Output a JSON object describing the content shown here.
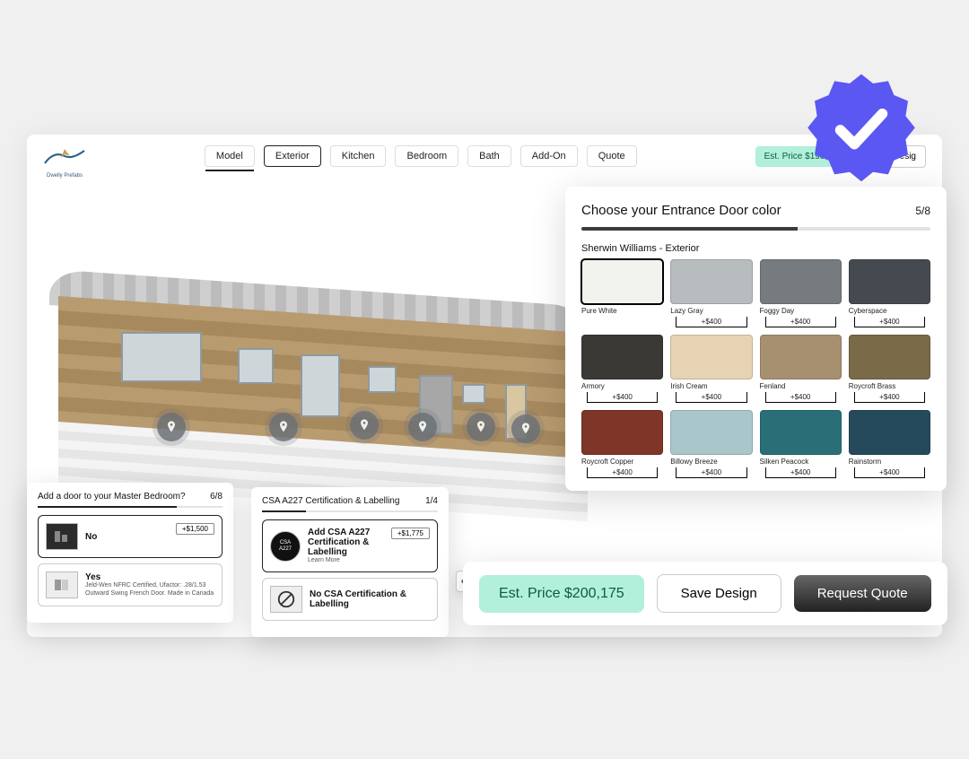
{
  "brand": {
    "name": "Dwelly Prefabs"
  },
  "tabs": [
    "Model",
    "Exterior",
    "Kitchen",
    "Bedroom",
    "Bath",
    "Add-On",
    "Quote"
  ],
  "active_tab_index": 1,
  "completed_tab_index": 0,
  "header_price_label": "Est. Price $198,000",
  "header_save_label": "Save Desig",
  "color_panel": {
    "title": "Choose your Entrance Door color",
    "step": "5/8",
    "progress_pct": 62,
    "subtitle": "Sherwin Williams - Exterior",
    "swatches": [
      {
        "name": "Pure White",
        "hex": "#f2f2ef",
        "price": "",
        "selected": true
      },
      {
        "name": "Lazy Gray",
        "hex": "#b7bcbf",
        "price": "+$400",
        "selected": false
      },
      {
        "name": "Foggy Day",
        "hex": "#767b7f",
        "price": "+$400",
        "selected": false
      },
      {
        "name": "Cyberspace",
        "hex": "#444a50",
        "price": "+$400",
        "selected": false
      },
      {
        "name": "Armory",
        "hex": "#3b3936",
        "price": "+$400",
        "selected": false
      },
      {
        "name": "Irish Cream",
        "hex": "#e5d3b3",
        "price": "+$400",
        "selected": false
      },
      {
        "name": "Fenland",
        "hex": "#a79070",
        "price": "+$400",
        "selected": false
      },
      {
        "name": "Roycroft Brass",
        "hex": "#7a6a47",
        "price": "+$400",
        "selected": false
      },
      {
        "name": "Roycroft Copper",
        "hex": "#7d3627",
        "price": "+$400",
        "selected": false
      },
      {
        "name": "Billowy Breeze",
        "hex": "#a9c7cb",
        "price": "+$400",
        "selected": false
      },
      {
        "name": "Silken Peacock",
        "hex": "#2a6e77",
        "price": "+$400",
        "selected": false
      },
      {
        "name": "Rainstorm",
        "hex": "#254a5c",
        "price": "+$400",
        "selected": false
      }
    ]
  },
  "callout_a": {
    "title": "Add a door to your Master Bedroom?",
    "step": "6/8",
    "progress_pct": 75,
    "options": [
      {
        "label": "No",
        "desc": "",
        "price": "+$1,500"
      },
      {
        "label": "Yes",
        "desc": "Jeld-Wen NFRC Certified, Ufactor: .28/1.53 Outward Swing French Door. Made in Canada",
        "price": ""
      }
    ]
  },
  "callout_b": {
    "title": "CSA A227 Certification & Labelling",
    "step": "1/4",
    "progress_pct": 25,
    "options": [
      {
        "label": "Add CSA A227 Certification & Labelling",
        "sublabel": "Learn More",
        "price": "+$1,775"
      },
      {
        "label": "No CSA Certification & Labelling",
        "sublabel": "",
        "price": ""
      }
    ]
  },
  "action_bar": {
    "estimate_label": "Est. Price $200,175",
    "save_label": "Save Design",
    "quote_label": "Request Quote"
  },
  "badge_color": "#5b57f2"
}
